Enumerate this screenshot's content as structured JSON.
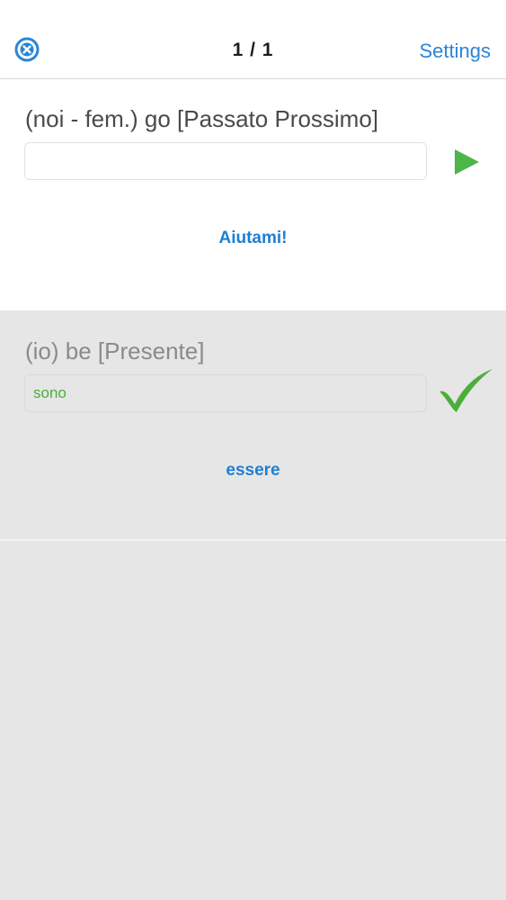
{
  "nav": {
    "close_icon": "close-circle-icon",
    "counter": "1 / 1",
    "settings_label": "Settings",
    "accent_color": "#2a86d6"
  },
  "current_question": {
    "prompt": "(noi - fem.) go [Passato Prossimo]",
    "answer_value": "",
    "submit_icon": "play-icon",
    "help_label": "Aiutami!"
  },
  "previous_question": {
    "prompt": "(io) be [Presente]",
    "answer_value": "sono",
    "status_icon": "checkmark-icon",
    "status_color": "#4cae39",
    "infinitive_label": "essere"
  }
}
